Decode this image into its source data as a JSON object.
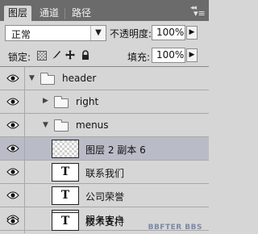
{
  "panel": {
    "tabs": [
      {
        "label": "图层",
        "active": true
      },
      {
        "label": "通道",
        "active": false
      },
      {
        "label": "路径",
        "active": false
      }
    ]
  },
  "controls": {
    "blend_mode": "正常",
    "opacity_label": "不透明度:",
    "opacity_value": "100%",
    "lock_label": "锁定:",
    "fill_label": "填充:",
    "fill_value": "100%"
  },
  "layers": [
    {
      "name": "header",
      "type": "group",
      "expanded": true,
      "depth": 0,
      "visible": true,
      "selected": false
    },
    {
      "name": "right",
      "type": "group",
      "expanded": false,
      "depth": 1,
      "visible": true,
      "selected": false
    },
    {
      "name": "menus",
      "type": "group",
      "expanded": true,
      "depth": 1,
      "visible": true,
      "selected": false
    },
    {
      "name": "图层 2 副本 6",
      "type": "pixel",
      "depth": 2,
      "visible": true,
      "selected": true
    },
    {
      "name": "联系我们",
      "type": "text",
      "depth": 2,
      "visible": true,
      "selected": false
    },
    {
      "name": "公司荣誉",
      "type": "text",
      "depth": 2,
      "visible": true,
      "selected": false
    },
    {
      "name": "服务客户",
      "type": "text",
      "depth": 2,
      "visible": true,
      "selected": false
    },
    {
      "name": "技术支持",
      "type": "text",
      "depth": 2,
      "visible": true,
      "selected": false
    }
  ],
  "thumb_glyph": "T",
  "watermark": "BBFTER BBS",
  "colors": {
    "selected_row": "#b9bcc7",
    "tab_bar": "#6b6b6b",
    "panel_bg": "#d6d6d6"
  }
}
